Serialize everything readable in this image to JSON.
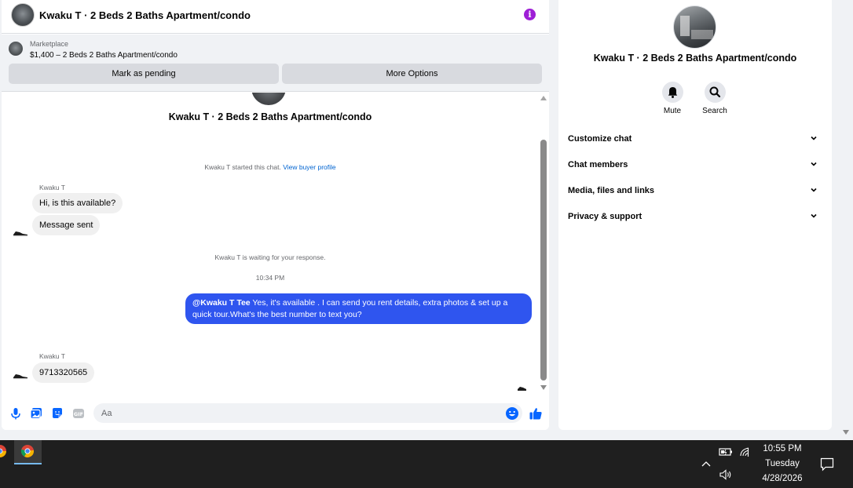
{
  "header": {
    "title": "Kwaku T · 2 Beds 2 Baths Apartment/condo",
    "info_icon": "info-icon"
  },
  "listing": {
    "source": "Marketplace",
    "price_title": "$1,400 – 2 Beds 2 Baths Apartment/condo",
    "mark_pending_label": "Mark as pending",
    "more_options_label": "More Options"
  },
  "conversation": {
    "title": "Kwaku T · 2 Beds 2 Baths Apartment/condo",
    "started_text": "Kwaku T started this chat.",
    "view_profile_link": "View buyer profile",
    "sender_name": "Kwaku T",
    "msg_1": "Hi, is this available?",
    "msg_2": "Message sent",
    "waiting_text": "Kwaku T is waiting for your response.",
    "timestamp": "10:34 PM",
    "out_mention": "@Kwaku T Tee",
    "out_text": " Yes, it's available .  I can send you rent details, extra photos & set up a quick tour.What's the best number to text you?",
    "sender_name_2": "Kwaku T",
    "msg_3": "9713320565"
  },
  "composer": {
    "placeholder": "Aa",
    "icons": [
      "microphone-icon",
      "photo-icon",
      "sticker-icon",
      "gif-icon",
      "emoji-icon",
      "thumbs-up-icon"
    ]
  },
  "info_panel": {
    "title": "Kwaku T · 2 Beds 2 Baths Apartment/condo",
    "mute_label": "Mute",
    "search_label": "Search",
    "sections": [
      "Customize chat",
      "Chat members",
      "Media, files and links",
      "Privacy & support"
    ]
  },
  "taskbar": {
    "time": "10:55 PM",
    "day": "Tuesday",
    "date": "4/28/2026"
  },
  "colors": {
    "accent_blue": "#2f55ef",
    "info_purple": "#9e1fd6",
    "link_blue": "#0064d1",
    "like_blue": "#0866ff"
  }
}
